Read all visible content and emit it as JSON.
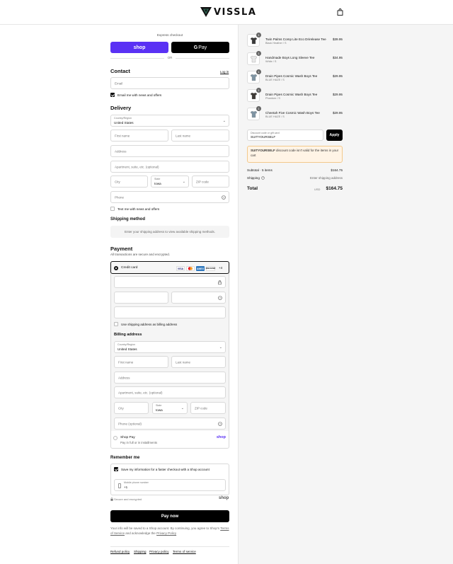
{
  "brand": {
    "name": "VISSLA"
  },
  "express": {
    "label": "Express checkout",
    "shop_label": "shop",
    "gpay_label": "Pay",
    "or_label": "OR"
  },
  "contact": {
    "title": "Contact",
    "login_label": "Log in",
    "email_placeholder": "Email",
    "email_news_label": "Email me with news and offers"
  },
  "delivery": {
    "title": "Delivery",
    "country_label": "Country/Region",
    "country_value": "United States",
    "first_name": "First name",
    "last_name": "Last name",
    "address": "Address",
    "apartment": "Apartment, suite, etc. (optional)",
    "city": "City",
    "state_label": "State",
    "state_value": "Iowa",
    "zip": "ZIP code",
    "phone": "Phone",
    "text_news_label": "Text me with news and offers"
  },
  "shipping_method": {
    "title": "Shipping method",
    "message": "Enter your shipping address to view available shipping methods."
  },
  "payment": {
    "title": "Payment",
    "subtitle": "All transactions are secure and encrypted.",
    "credit_card_label": "Credit card",
    "card_brands": [
      "VISA",
      "MC",
      "AMEX",
      "DISCOVER"
    ],
    "more_label": "+4",
    "use_shipping_label": "Use shipping address as billing address",
    "billing_title": "Billing address",
    "billing_country_label": "Country/Region",
    "billing_country_value": "United States",
    "billing_first_name": "First name",
    "billing_last_name": "Last name",
    "billing_address": "Address",
    "billing_apartment": "Apartment, suite, etc. (optional)",
    "billing_city": "City",
    "billing_state_label": "State",
    "billing_state_value": "Iowa",
    "billing_zip": "ZIP code",
    "billing_phone": "Phone (optional)",
    "shop_pay_label": "Shop Pay",
    "shop_pay_sub": "Pay in full or in installments",
    "shop_pay_logo": "shop"
  },
  "remember": {
    "title": "Remember me",
    "save_label": "Save my information for a faster checkout with a Shop account",
    "mobile_label": "Mobile phone number",
    "mobile_prefix": "+1",
    "secure_label": "Secure and encrypted",
    "shop_logo": "shop"
  },
  "pay_now_label": "Pay now",
  "disclaimer": {
    "text": "Your info will be saved to a Shop account. By continuing, you agree to Shop's",
    "terms": "Terms of Service",
    "and_ack": "and acknowledge the",
    "privacy": "Privacy Policy"
  },
  "footer_links": [
    "Refund policy",
    "Shipping",
    "Privacy policy",
    "Terms of service"
  ],
  "order": {
    "items": [
      {
        "name": "Twin Palms Comp Lite Eco Drirelease Tee",
        "variant": "Black Heather / S",
        "price": "$39.95",
        "qty": "1",
        "color": "#3a3a3a"
      },
      {
        "name": "Handmade Boys Long Sleeve Tee",
        "variant": "White / S",
        "price": "$34.95",
        "qty": "1",
        "color": "#e8e8e8"
      },
      {
        "name": "Drain Pipes Cosmic Wash Boys Tee",
        "variant": "BLUE HAZE / S",
        "price": "$29.95",
        "qty": "1",
        "color": "#7f94a3"
      },
      {
        "name": "Drain Pipes Cosmic Wash Boys Tee",
        "variant": "Phantom / S",
        "price": "$29.95",
        "qty": "1",
        "color": "#3e3a36"
      },
      {
        "name": "Cheetah Five Cosmic Wash Boys Tee",
        "variant": "BLUE HAZE / S",
        "price": "$29.95",
        "qty": "1",
        "color": "#7f94a3"
      }
    ],
    "discount_label": "Discount code or gift card",
    "discount_value": "SUITYOURSELF",
    "apply_label": "Apply",
    "warning_code": "SUITYOURSELF",
    "warning_text": "discount code isn't valid for the items in your cart",
    "subtotal_label": "Subtotal · 5 items",
    "subtotal_value": "$164.75",
    "shipping_label": "Shipping",
    "shipping_value": "Enter shipping address",
    "total_label": "Total",
    "currency": "USD",
    "total_value": "$164.75"
  }
}
